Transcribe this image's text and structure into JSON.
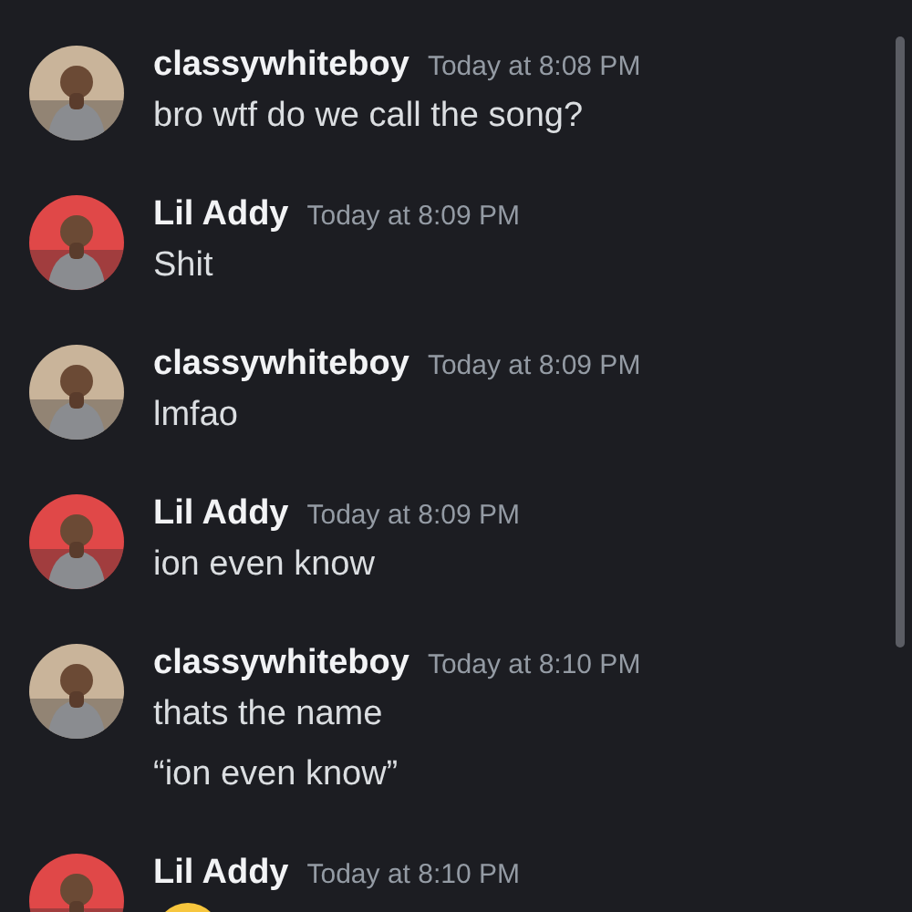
{
  "messages": [
    {
      "author": "classywhiteboy",
      "time": "Today at 8:08 PM",
      "color": "#c9b49a",
      "lines": [
        {
          "kind": "text",
          "text": "bro wtf do we call the song?"
        }
      ]
    },
    {
      "author": "Lil Addy",
      "time": "Today at 8:09 PM",
      "color": "#e04848",
      "lines": [
        {
          "kind": "text",
          "text": "Shit"
        }
      ]
    },
    {
      "author": "classywhiteboy",
      "time": "Today at 8:09 PM",
      "color": "#c9b49a",
      "lines": [
        {
          "kind": "text",
          "text": "lmfao"
        }
      ]
    },
    {
      "author": "Lil Addy",
      "time": "Today at 8:09 PM",
      "color": "#e04848",
      "lines": [
        {
          "kind": "text",
          "text": "ion even know"
        }
      ]
    },
    {
      "author": "classywhiteboy",
      "time": "Today at 8:10 PM",
      "color": "#c9b49a",
      "lines": [
        {
          "kind": "text",
          "text": "thats the name"
        },
        {
          "kind": "text",
          "text": "“ion even know”"
        }
      ]
    },
    {
      "author": "Lil Addy",
      "time": "Today at 8:10 PM",
      "color": "#e04848",
      "lines": [
        {
          "kind": "emoji"
        }
      ]
    }
  ]
}
